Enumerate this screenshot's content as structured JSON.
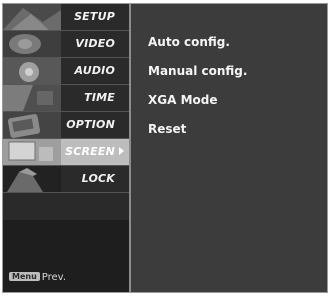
{
  "sidebar": {
    "items": [
      {
        "label": "SETUP",
        "icon": "setup-image-icon"
      },
      {
        "label": "VIDEO",
        "icon": "video-image-icon"
      },
      {
        "label": "AUDIO",
        "icon": "audio-image-icon"
      },
      {
        "label": "TIME",
        "icon": "time-image-icon"
      },
      {
        "label": "OPTION",
        "icon": "option-image-icon"
      },
      {
        "label": "SCREEN",
        "icon": "screen-image-icon",
        "selected": true
      },
      {
        "label": "LOCK",
        "icon": "lock-image-icon"
      }
    ],
    "footer": {
      "key_label": "Menu",
      "action_label": "Prev."
    }
  },
  "submenu": {
    "items": [
      {
        "label": "Auto config."
      },
      {
        "label": "Manual config."
      },
      {
        "label": "XGA Mode"
      },
      {
        "label": "Reset"
      }
    ]
  },
  "colors": {
    "panel_bg": "#3c3c3c",
    "sidebar_bg": "#2a2a2a",
    "selected_bg": "#bdbdbd",
    "text": "#f5f5f5"
  }
}
